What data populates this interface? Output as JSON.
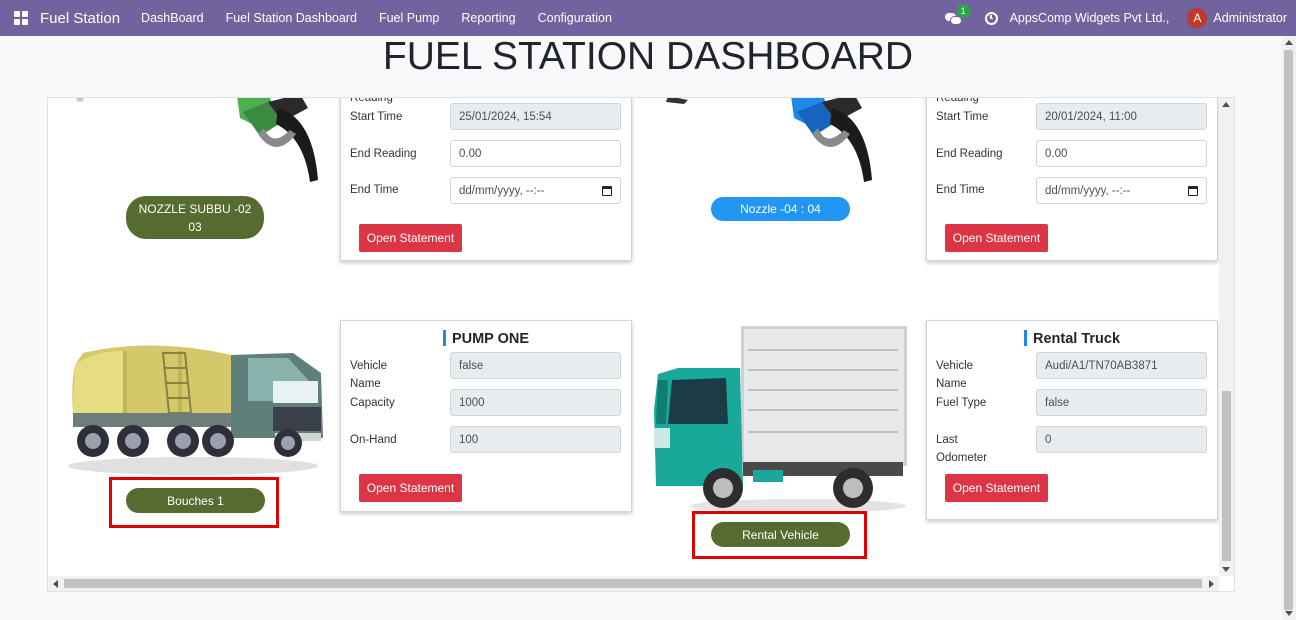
{
  "navbar": {
    "brand": "Fuel Station",
    "menu": [
      "DashBoard",
      "Fuel Station Dashboard",
      "Fuel Pump",
      "Reporting",
      "Configuration"
    ],
    "chat_badge": "1",
    "company": "AppsComp Widgets Pvt Ltd.,",
    "avatar_letter": "A",
    "user": "Administrator"
  },
  "page_title": "FUEL STATION DASHBOARD",
  "nozzles": [
    {
      "pill_label": "NOZZLE SUBBU -02\n03",
      "reading_label": "Reading",
      "start_time_label": "Start Time",
      "start_time": "25/01/2024, 15:54",
      "end_reading_label": "End Reading",
      "end_reading": "0.00",
      "end_time_label": "End Time",
      "end_time_placeholder": "dd/mm/yyyy, --:--",
      "button": "Open Statement",
      "nozzle_color": "#4caf50"
    },
    {
      "pill_label": "Nozzle -04 : 04",
      "reading_label": "Reading",
      "start_time_label": "Start Time",
      "start_time": "20/01/2024, 11:00",
      "end_reading_label": "End Reading",
      "end_reading": "0.00",
      "end_time_label": "End Time",
      "end_time_placeholder": "dd/mm/yyyy, --:--",
      "button": "Open Statement",
      "nozzle_color": "#1e88e5"
    }
  ],
  "pump_card": {
    "title": "PUMP ONE",
    "vehicle_name_label": "Vehicle\nName",
    "vehicle_name": "false",
    "capacity_label": "Capacity",
    "capacity": "1000",
    "onhand_label": "On-Hand",
    "onhand": "100",
    "button": "Open Statement",
    "pill_label": "Bouches 1"
  },
  "truck_card": {
    "title": "Rental Truck",
    "vehicle_name_label": "Vehicle\nName",
    "vehicle_name": "Audi/A1/TN70AB3871",
    "fuel_type_label": "Fuel Type",
    "fuel_type": "false",
    "last_odometer_label": "Last\nOdometer",
    "last_odometer": "0",
    "button": "Open Statement",
    "pill_label": "Rental Vehicle"
  },
  "colors": {
    "navbar": "#71639e",
    "pill_green": "#556b2f",
    "pill_blue": "#2196f3",
    "button_red": "#dc3545",
    "highlight_box": "#e00000"
  }
}
